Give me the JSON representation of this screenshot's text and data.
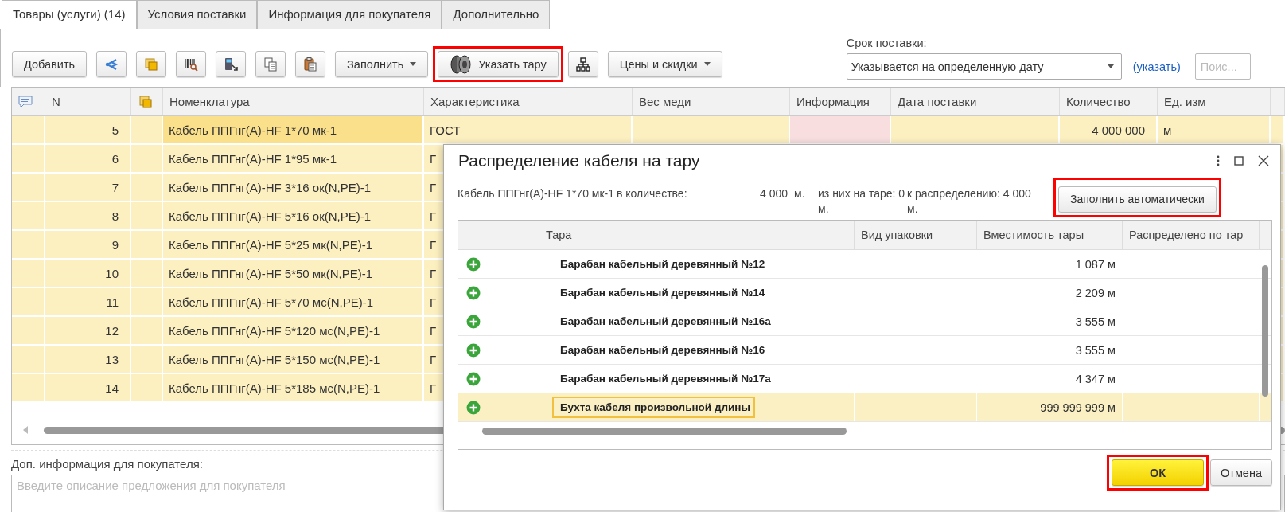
{
  "tabs": [
    {
      "label": "Товары (услуги) (14)",
      "selected": true
    },
    {
      "label": "Условия поставки",
      "selected": false
    },
    {
      "label": "Информация для покупателя",
      "selected": false
    },
    {
      "label": "Дополнительно",
      "selected": false
    }
  ],
  "toolbar": {
    "items": [
      {
        "kind": "button",
        "label": "Добавить",
        "highlighted": false
      },
      {
        "kind": "icon",
        "highlighted": false
      },
      {
        "kind": "icon",
        "highlighted": false
      },
      {
        "kind": "icon",
        "highlighted": false
      },
      {
        "kind": "icon",
        "highlighted": false
      },
      {
        "kind": "icon",
        "highlighted": false
      },
      {
        "kind": "icon",
        "highlighted": false
      },
      {
        "kind": "dropdown",
        "label": "Заполнить",
        "highlighted": false
      },
      {
        "kind": "reel",
        "label": "Указать тару",
        "highlighted": true
      },
      {
        "kind": "icon",
        "highlighted": false
      },
      {
        "kind": "dropdown",
        "label": "Цены и скидки",
        "highlighted": false
      }
    ]
  },
  "delivery": {
    "label": "Срок поставки:",
    "value": "Указывается на определенную дату",
    "link": "(указать)"
  },
  "search": {
    "placeholder": "Поис..."
  },
  "table": {
    "columns": [
      "N",
      "Номенклатура",
      "Характеристика",
      "Вес меди",
      "Информация",
      "Дата поставки",
      "Количество",
      "Ед. изм"
    ],
    "rows": [
      {
        "n": "5",
        "name": "Кабель ППГнг(А)-HF 1*70 мк-1",
        "characteristic": "ГОСТ",
        "quantity": "4 000 000",
        "unit": "м",
        "current": true
      },
      {
        "n": "6",
        "name": "Кабель ППГнг(А)-HF 1*95 мк-1",
        "characteristic": "Г",
        "current": false
      },
      {
        "n": "7",
        "name": "Кабель ППГнг(А)-HF 3*16 ок(N,PE)-1",
        "characteristic": "Г",
        "current": false
      },
      {
        "n": "8",
        "name": "Кабель ППГнг(А)-HF 5*16 ок(N,PE)-1",
        "characteristic": "Г",
        "current": false
      },
      {
        "n": "9",
        "name": "Кабель ППГнг(А)-HF 5*25 мк(N,PE)-1",
        "characteristic": "Г",
        "current": false
      },
      {
        "n": "10",
        "name": "Кабель ППГнг(А)-HF 5*50 мк(N,PE)-1",
        "characteristic": "Г",
        "current": false
      },
      {
        "n": "11",
        "name": "Кабель ППГнг(А)-HF 5*70 мс(N,PE)-1",
        "characteristic": "Г",
        "current": false
      },
      {
        "n": "12",
        "name": "Кабель ППГнг(А)-HF 5*120 мс(N,PE)-1",
        "characteristic": "Г",
        "current": false
      },
      {
        "n": "13",
        "name": "Кабель ППГнг(А)-HF 5*150 мс(N,PE)-1",
        "characteristic": "Г",
        "current": false
      },
      {
        "n": "14",
        "name": "Кабель ППГнг(А)-HF 5*185 мс(N,PE)-1",
        "characteristic": "Г",
        "current": false
      }
    ]
  },
  "info": {
    "label": "Доп. информация для покупателя:",
    "placeholder": "Введите описание предложения для покупателя"
  },
  "dialog": {
    "title": "Распределение кабеля на тару",
    "item": "Кабель ППГнг(А)-HF 1*70 мк-1",
    "quantity_label": "в количестве:",
    "quantity": "4 000",
    "unit": "м.",
    "on_tare": "из них на таре: 0 м.",
    "to_distribute": "к распределению: 4 000 м.",
    "fill_button": {
      "label": "Заполнить автоматически",
      "highlighted": true
    },
    "columns": [
      "Тара",
      "Вид упаковки",
      "Вместимость тары",
      "Распределено по тар"
    ],
    "rows": [
      {
        "name": "Барабан кабельный деревянный №12",
        "capacity": "1 087 м",
        "selected": false
      },
      {
        "name": "Барабан кабельный деревянный №14",
        "capacity": "2 209 м",
        "selected": false
      },
      {
        "name": "Барабан кабельный деревянный №16а",
        "capacity": "3 555 м",
        "selected": false
      },
      {
        "name": "Барабан кабельный деревянный №16",
        "capacity": "3 555 м",
        "selected": false
      },
      {
        "name": "Барабан кабельный деревянный №17а",
        "capacity": "4 347 м",
        "selected": false
      },
      {
        "name": "Бухта кабеля произвольной длины",
        "capacity": "999 999 999 м",
        "selected": true
      }
    ],
    "ok_button": {
      "label": "ОК",
      "highlighted": true
    },
    "cancel_button": {
      "label": "Отмена"
    }
  }
}
